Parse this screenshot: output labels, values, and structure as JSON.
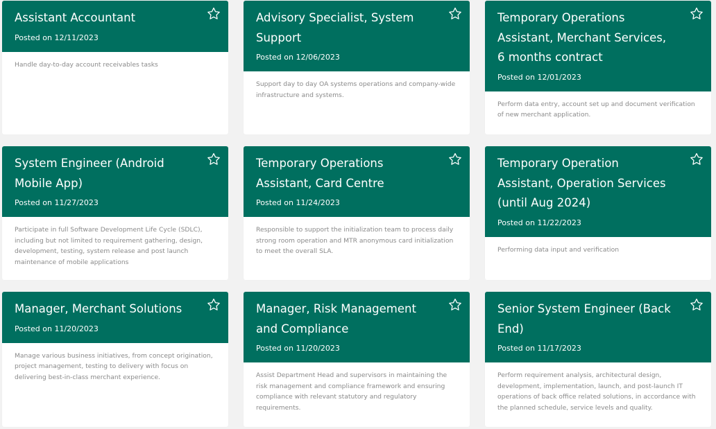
{
  "posted_prefix": "Posted on",
  "colors": {
    "header_bg": "#006f5f",
    "page_bg": "#f2f2f2",
    "card_bg": "#ffffff",
    "body_text": "#8a8a8a"
  },
  "jobs": [
    {
      "title": "Assistant Accountant",
      "date": "12/11/2023",
      "description": "Handle day-to-day account receivables tasks",
      "icon": "star-outline-icon"
    },
    {
      "title": "Advisory Specialist, System Support",
      "date": "12/06/2023",
      "description": "Support day to day OA systems operations and company-wide infrastructure and systems.",
      "icon": "star-outline-icon"
    },
    {
      "title": "Temporary Operations Assistant, Merchant Services, 6 months contract",
      "date": "12/01/2023",
      "description": "Perform data entry, account set up and document verification of new merchant application.",
      "icon": "star-outline-icon"
    },
    {
      "title": "System Engineer (Android Mobile App)",
      "date": "11/27/2023",
      "description": "Participate in full Software Development Life Cycle (SDLC), including but not limited to requirement gathering, design, development, testing, system release and post launch maintenance of mobile applications",
      "icon": "star-outline-icon"
    },
    {
      "title": "Temporary Operations Assistant, Card Centre",
      "date": "11/24/2023",
      "description": "Responsible to support the initialization team to process daily strong room operation and MTR anonymous card initialization to meet the overall SLA.",
      "icon": "star-outline-icon"
    },
    {
      "title": "Temporary Operation Assistant, Operation Services (until Aug 2024)",
      "date": "11/22/2023",
      "description": "Performing data input and verification",
      "icon": "star-outline-icon"
    },
    {
      "title": "Manager, Merchant Solutions",
      "date": "11/20/2023",
      "description": "Manage various business initiatives, from concept origination, project management, testing to delivery with focus on delivering best-in-class merchant experience.",
      "icon": "star-outline-icon"
    },
    {
      "title": "Manager, Risk Management and Compliance",
      "date": "11/20/2023",
      "description": "Assist Department Head and supervisors in maintaining the risk management and compliance framework and ensuring compliance with relevant statutory and regulatory requirements.",
      "icon": "star-outline-icon"
    },
    {
      "title": "Senior System Engineer (Back End)",
      "date": "11/17/2023",
      "description": "Perform requirement analysis, architectural design, development, implementation, launch, and post-launch IT operations of back office related solutions, in accordance with the planned schedule, service levels and quality.",
      "icon": "star-outline-icon"
    }
  ]
}
